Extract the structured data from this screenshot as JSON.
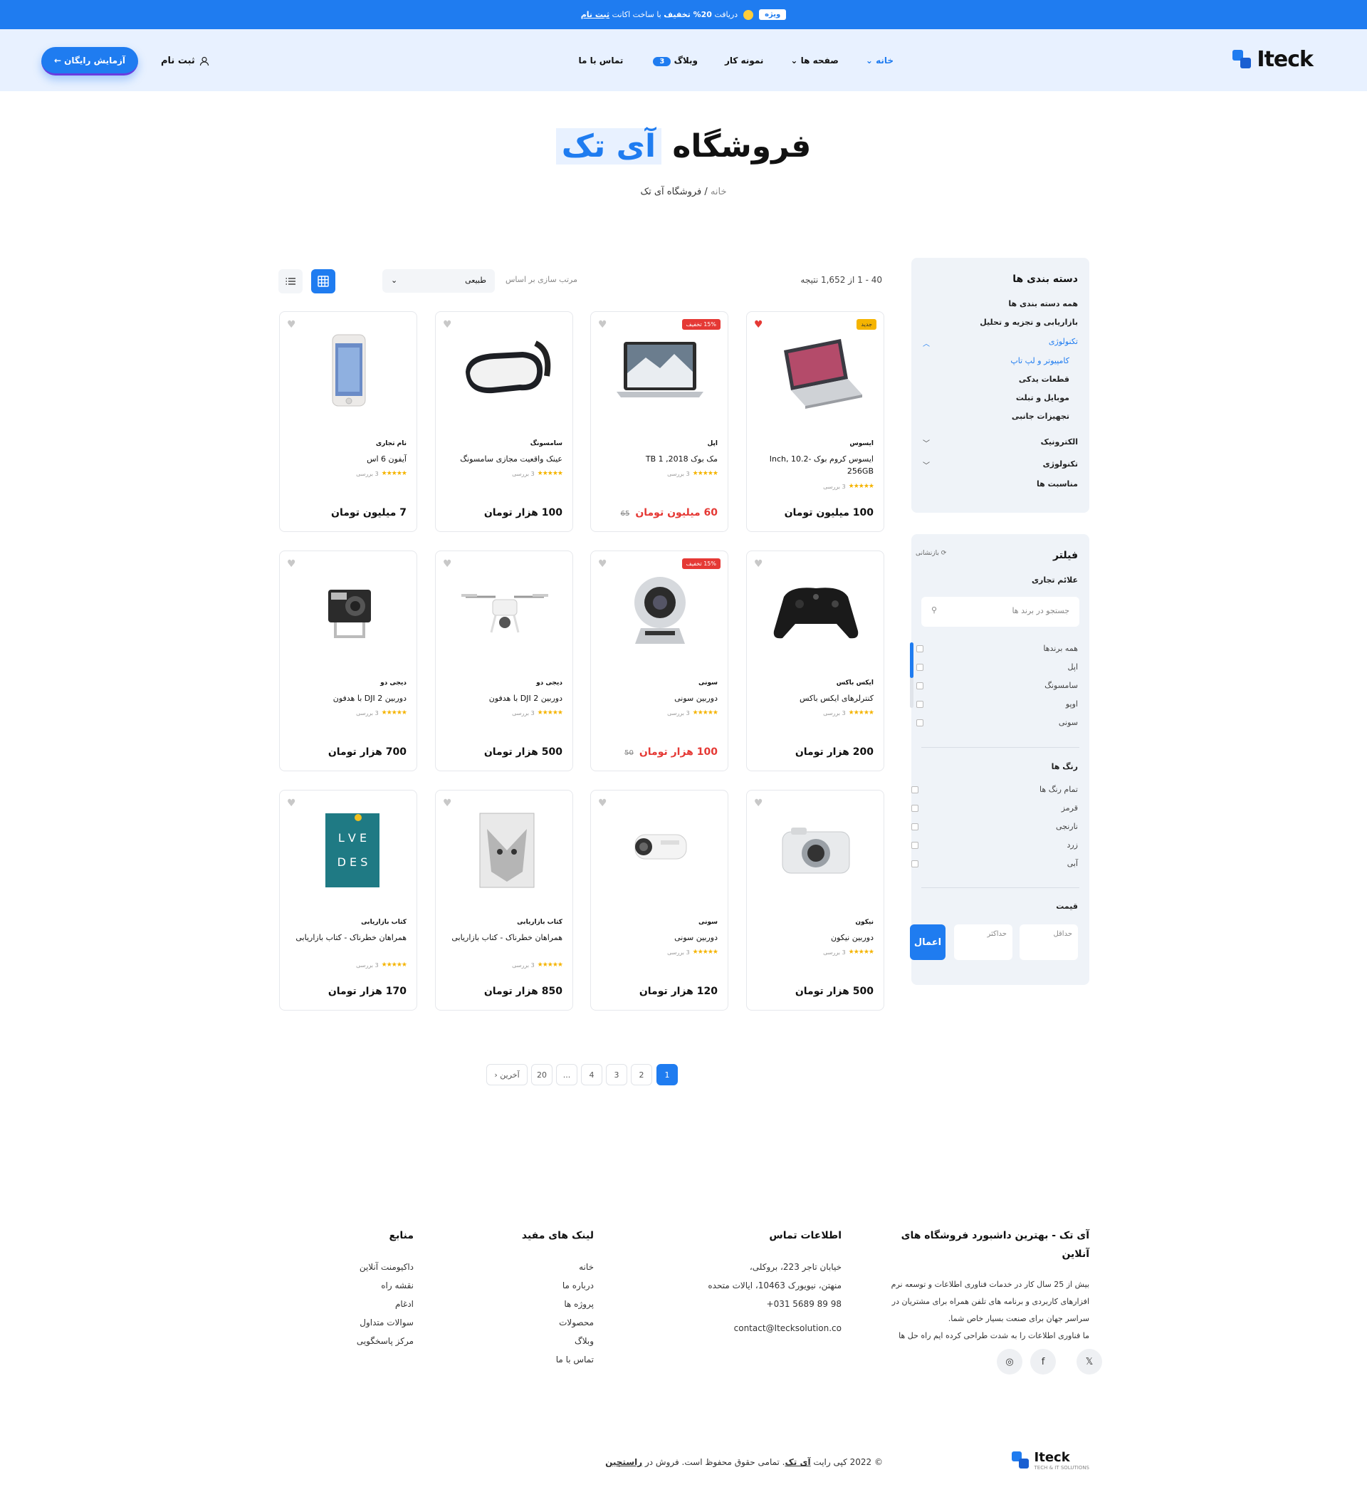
{
  "topbar": {
    "badge": "ویژه",
    "text": "دریافت ",
    "offer": "20% تخفیف",
    "text2": " با ساخت اکانت ",
    "link": "ثبت نام"
  },
  "header": {
    "logo": "Iteck",
    "nav": [
      {
        "label": "خانه",
        "arrow": "⌄"
      },
      {
        "label": "صفحه ها",
        "arrow": "⌄"
      },
      {
        "label": "نمونه کار"
      },
      {
        "label": "وبلاگ",
        "count": "3"
      },
      {
        "label": "تماس با ما"
      }
    ],
    "signup": "ثبت نام",
    "trial": "آزمایش رایگان ←"
  },
  "hero": {
    "title": "فروشگاه",
    "highlight": "آی تک",
    "crumb_home": "خانه",
    "crumb_sep": "/",
    "crumb_current": "فروشگاه آی تک"
  },
  "categories": {
    "title": "دسته بندی ها",
    "items": [
      "همه دسته بندی ها",
      "بازاریابی و تجزیه و تحلیل",
      "تکنولوژی",
      "کامپیوتر و لپ تاپ",
      "قطعات یدکی",
      "موبایل و تبلت",
      "تجهیزات جانبی",
      "الکترونیک",
      "تکنولوژی",
      "مناسبت ها"
    ]
  },
  "filter": {
    "title": "فیلتر",
    "reset": "بازنشانی",
    "brands_title": "علائم تجاری",
    "search_placeholder": "جستجو در برند ها",
    "brands": [
      "همه برندها",
      "اپل",
      "سامسونگ",
      "اوپو",
      "سونی"
    ],
    "colors_title": "رنگ ها",
    "colors": [
      "تمام رنگ ها",
      "قرمز",
      "نارنجی",
      "زرد",
      "آبی"
    ],
    "price_title": "قیمت",
    "min": "حداقل",
    "max": "حداکثر",
    "apply": "اعمال"
  },
  "toolbar": {
    "results": "40 - 1 از 1,652 نتیجه",
    "sort_label": "مرتب سازی بر اساس",
    "sort_value": "طبیعی"
  },
  "products": [
    {
      "brand": "ایسوس",
      "name": "ایسوس کروم بوک -Inch, 10.2 256GB",
      "reviews": "3 بررسی",
      "price": "100 میلیون تومان",
      "tag": "جدید",
      "liked": true
    },
    {
      "brand": "اپل",
      "name": "مک بوک 2018, TB 1",
      "reviews": "3 بررسی",
      "price": "60 میلیون تومان",
      "old": "65",
      "tag": "15% تخفیف"
    },
    {
      "brand": "سامسونگ",
      "name": "عینک واقعیت مجازی سامسونگ",
      "reviews": "3 بررسی",
      "price": "100 هزار تومان"
    },
    {
      "brand": "نام تجاری",
      "name": "آیفون 6 اس",
      "reviews": "3 بررسی",
      "price": "7 میلیون تومان"
    },
    {
      "brand": "ایکس باکس",
      "name": "کنترلرهای ایکس باکس",
      "reviews": "3 بررسی",
      "price": "200 هزار تومان"
    },
    {
      "brand": "سونی",
      "name": "دوربین سونی",
      "reviews": "3 بررسی",
      "price": "100 هزار تومان",
      "old": "50",
      "tag": "15% تخفیف"
    },
    {
      "brand": "دیجی دو",
      "name": "دوربین DJI 2 با هدفون",
      "reviews": "3 بررسی",
      "price": "500 هزار تومان"
    },
    {
      "brand": "دیجی دو",
      "name": "دوربین DJI 2 با هدفون",
      "reviews": "3 بررسی",
      "price": "700 هزار تومان"
    },
    {
      "brand": "نیکون",
      "name": "دوربین نیکون",
      "reviews": "3 بررسی",
      "price": "500 هزار تومان"
    },
    {
      "brand": "سونی",
      "name": "دوربین سونی",
      "reviews": "3 بررسی",
      "price": "120 هزار تومان"
    },
    {
      "brand": "کتاب بازاریابی",
      "name": "همراهان خطرناک - کتاب بازاریابی",
      "reviews": "3 بررسی",
      "price": "850 هزار تومان"
    },
    {
      "brand": "کتاب بازاریابی",
      "name": "همراهان خطرناک - کتاب بازاریابی",
      "reviews": "3 بررسی",
      "price": "170 هزار تومان"
    }
  ],
  "pagination": [
    "1",
    "2",
    "3",
    "4",
    "...",
    "20",
    "آخرین"
  ],
  "footer": {
    "about_title": "آی تک - بهترین داشبورد فروشگاه های آنلاین",
    "about_text": [
      "بیش از 25 سال کار در خدمات فناوری اطلاعات و توسعه نرم",
      "افزارهای کاربردی و برنامه های تلفن همراه برای مشتریان در",
      "سراسر جهان برای صنعت بسیار خاص شما.",
      "ما فناوری اطلاعات را به شدت طراحی کرده ایم راه حل ها"
    ],
    "contact_title": "اطلاعات تماس",
    "contact": [
      "خیابان تاجر 223، بروکلی،",
      "منهتن، نیویورک 10463، ایالات متحده",
      "+031 5689 89 98",
      "contact@Itecksolution.co"
    ],
    "links_title": "لینک های مفید",
    "links": [
      "خانه",
      "درباره ما",
      "پروژه ها",
      "محصولات",
      "وبلاگ",
      "تماس با ما"
    ],
    "res_title": "منابع",
    "resources": [
      "داکیومنت آنلاین",
      "نقشه راه",
      "ادغام",
      "سوالات متداول",
      "مرکز پاسخگویی"
    ],
    "copyright": "© 2022 کپی رایت ",
    "brand_link": "آی تک",
    "copy_rest": ". تمامی حقوق محفوظ است. فروش در ",
    "market": "راستچین",
    "logo": "Iteck",
    "tagline": "TECH & IT SOLUTIONS"
  },
  "colors": {
    "primary": "#1f7cf0",
    "danger": "#e53935",
    "star": "#f5b400"
  }
}
